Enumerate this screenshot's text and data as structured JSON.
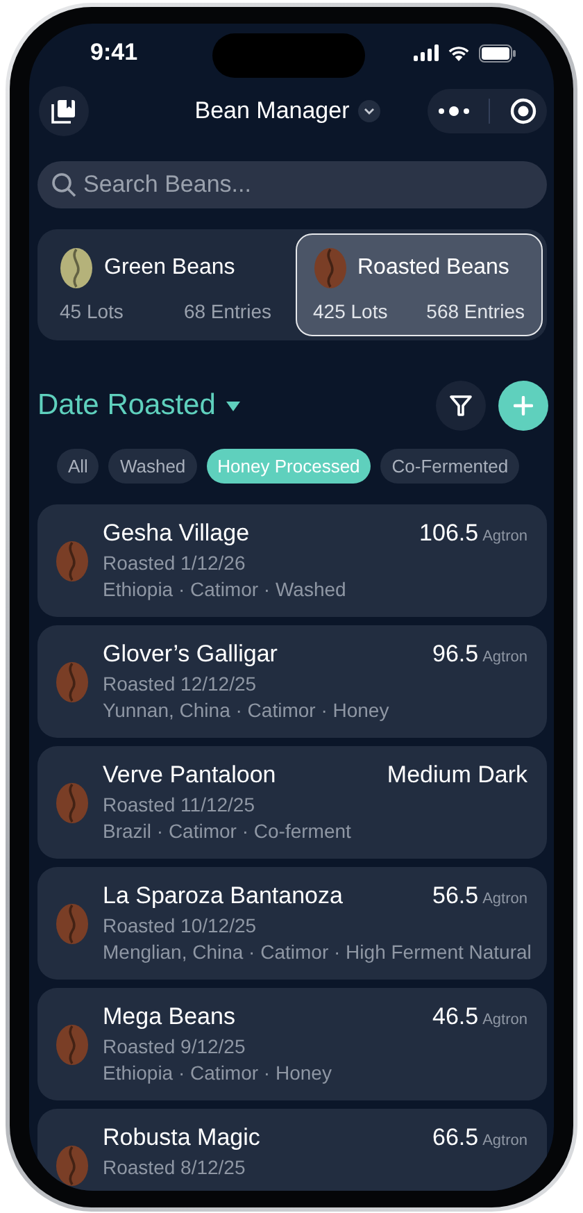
{
  "status_bar": {
    "time": "9:41"
  },
  "header": {
    "title": "Bean Manager"
  },
  "search": {
    "placeholder": "Search Beans..."
  },
  "segments": [
    {
      "title": "Green Beans",
      "lots": "45 Lots",
      "entries": "68 Entries",
      "color": "#b5b27a",
      "selected": false
    },
    {
      "title": "Roasted Beans",
      "lots": "425 Lots",
      "entries": "568 Entries",
      "color": "#7a3e26",
      "selected": true
    }
  ],
  "sort": {
    "label": "Date Roasted"
  },
  "filters": [
    {
      "label": "All",
      "selected": false
    },
    {
      "label": "Washed",
      "selected": false
    },
    {
      "label": "Honey Processed",
      "selected": true
    },
    {
      "label": "Co-Fermented",
      "selected": false
    }
  ],
  "beans": [
    {
      "name": "Gesha Village",
      "roasted": "Roasted 1/12/26",
      "meta": "Ethiopia · Catimor · Washed",
      "value": "106.5",
      "unit": "Agtron"
    },
    {
      "name": "Glover’s Galligar",
      "roasted": "Roasted 12/12/25",
      "meta": "Yunnan, China · Catimor · Honey",
      "value": "96.5",
      "unit": "Agtron"
    },
    {
      "name": "Verve Pantaloon",
      "roasted": "Roasted 11/12/25",
      "meta": "Brazil · Catimor · Co-ferment",
      "value": "Medium Dark"
    },
    {
      "name": "La Sparoza Bantanoza",
      "roasted": "Roasted 10/12/25",
      "meta": "Menglian, China · Catimor · High Ferment Natural",
      "value": "56.5",
      "unit": "Agtron"
    },
    {
      "name": "Mega Beans",
      "roasted": "Roasted 9/12/25",
      "meta": "Ethiopia · Catimor · Honey",
      "value": "46.5",
      "unit": "Agtron"
    },
    {
      "name": "Robusta Magic",
      "roasted": "Roasted 8/12/25",
      "value": "66.5",
      "unit": "Agtron"
    }
  ]
}
